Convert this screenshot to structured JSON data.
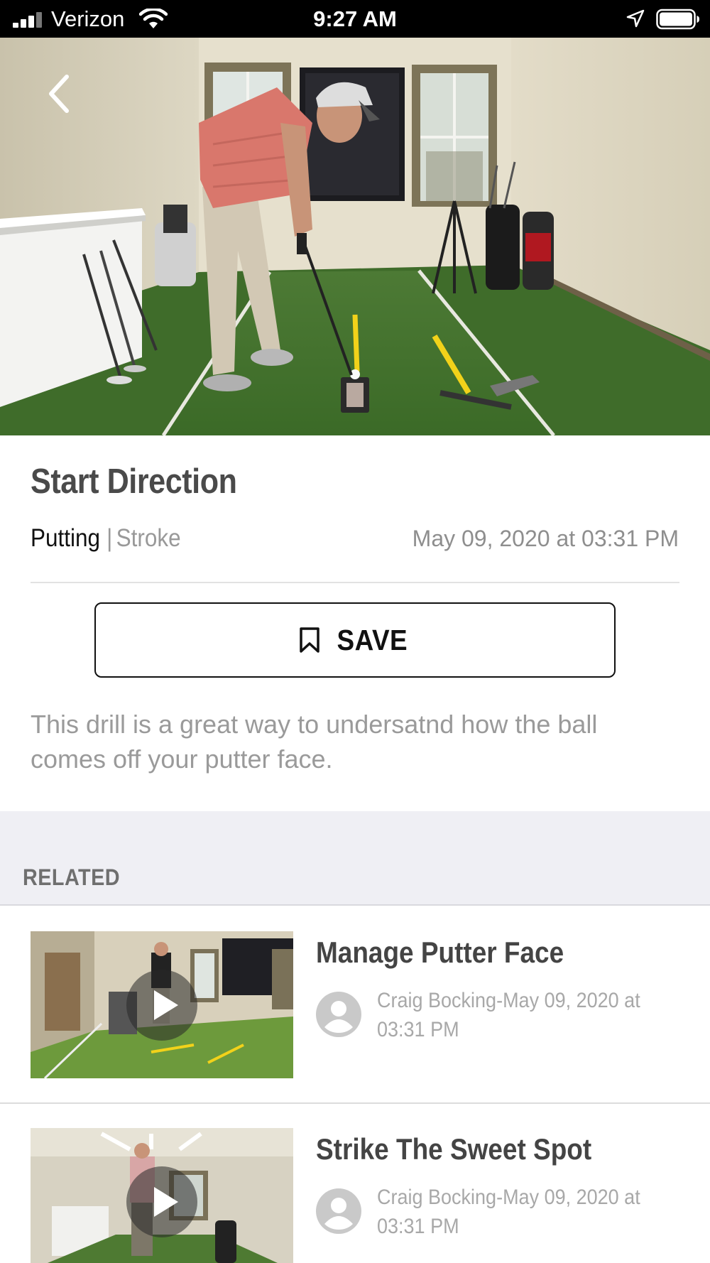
{
  "status_bar": {
    "carrier": "Verizon",
    "time": "9:27 AM"
  },
  "video": {
    "title": "Start Direction",
    "category": "Putting",
    "separator": "|",
    "subcategory": "Stroke",
    "date": "May 09, 2020 at 03:31 PM",
    "save_label": "SAVE",
    "description": "This drill is a great way to undersatnd how the ball comes off your putter face."
  },
  "related": {
    "heading": "RELATED",
    "items": [
      {
        "title": "Manage Putter Face",
        "byline": "Craig Bocking-May 09, 2020 at 03:31 PM"
      },
      {
        "title": "Strike The Sweet Spot",
        "byline": "Craig Bocking-May 09, 2020 at 03:31 PM"
      }
    ]
  },
  "icons": {
    "back": "chevron-left-icon",
    "save": "bookmark-icon",
    "play": "play-icon",
    "avatar": "user-avatar-icon",
    "wifi": "wifi-icon",
    "signal": "signal-icon",
    "location": "location-arrow-icon",
    "battery": "battery-icon"
  },
  "colors": {
    "status_bar_bg": "#000000",
    "related_band_bg": "#efeff4",
    "title_text": "#4a4a4a",
    "muted_text": "#9a9a9a"
  }
}
